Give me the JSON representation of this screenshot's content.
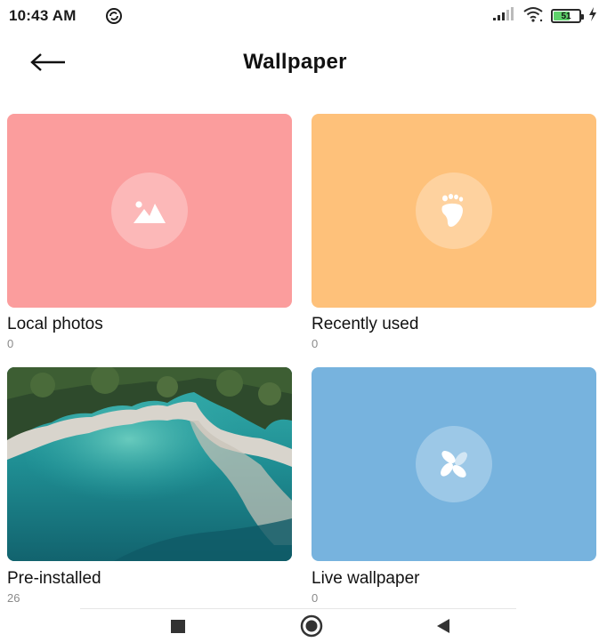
{
  "status_bar": {
    "time": "10:43 AM",
    "time_icon": "sync-circle-icon",
    "battery_level": "51",
    "icons": [
      "signal-icon",
      "wifi-icon",
      "battery-icon",
      "charging-icon"
    ]
  },
  "header": {
    "back_icon": "arrow-left-icon",
    "title": "Wallpaper"
  },
  "tiles": [
    {
      "label": "Local photos",
      "count": "0",
      "icon": "image-icon",
      "color": "#fb9d9d"
    },
    {
      "label": "Recently used",
      "count": "0",
      "icon": "footprint-icon",
      "color": "#fec17a"
    },
    {
      "label": "Pre-installed",
      "count": "26",
      "icon": "preview-image",
      "color": "#1e7e82"
    },
    {
      "label": "Live wallpaper",
      "count": "0",
      "icon": "pinwheel-icon",
      "color": "#77b3de"
    }
  ],
  "nav_bar": {
    "items": [
      "recents-square-icon",
      "home-circle-icon",
      "back-triangle-icon"
    ]
  }
}
